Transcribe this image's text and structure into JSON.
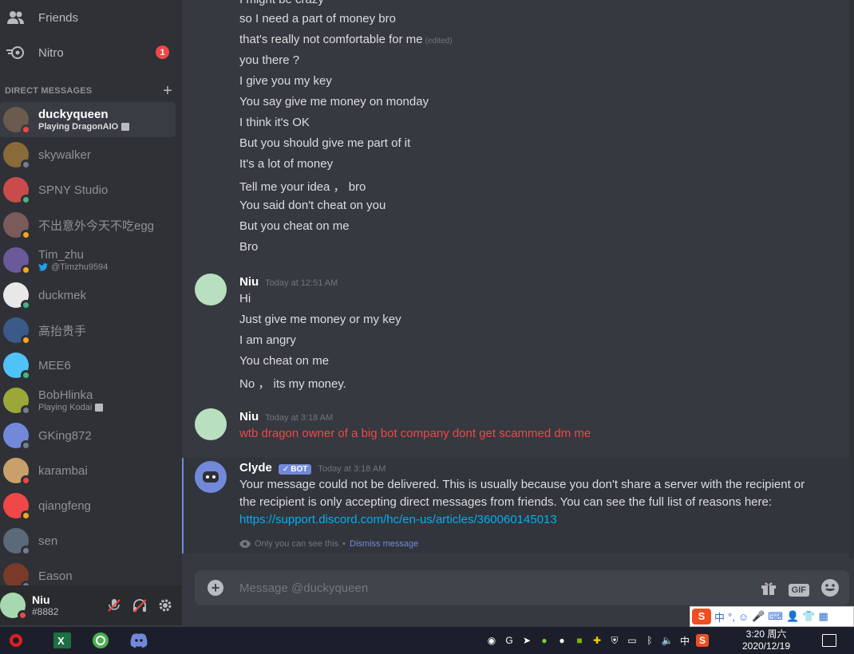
{
  "sidebar": {
    "nav": [
      {
        "label": "Friends",
        "icon": "friends-icon"
      },
      {
        "label": "Nitro",
        "icon": "nitro-icon",
        "badge": "1"
      }
    ],
    "dm_header": "DIRECT MESSAGES",
    "dms": [
      {
        "name": "duckyqueen",
        "sub": "Playing DragonAIO",
        "status": "dnd",
        "color": "#6b5a4e"
      },
      {
        "name": "skywalker",
        "sub": "",
        "status": "offline",
        "color": "#8b6a3a"
      },
      {
        "name": "SPNY Studio",
        "sub": "",
        "status": "online",
        "color": "#c94b4b"
      },
      {
        "name": "不出意外今天不吃egg",
        "sub": "",
        "status": "idle",
        "color": "#7a5a5a"
      },
      {
        "name": "Tim_zhu",
        "sub": "@Timzhu9594",
        "status": "idle",
        "color": "#6a5a9a"
      },
      {
        "name": "duckmek",
        "sub": "",
        "status": "online",
        "color": "#e8e8e8"
      },
      {
        "name": "高抬贵手",
        "sub": "",
        "status": "idle",
        "color": "#3b5a8a"
      },
      {
        "name": "MEE6",
        "sub": "",
        "status": "online",
        "color": "#4fc3f7"
      },
      {
        "name": "BobHlinka",
        "sub": "Playing Kodai",
        "status": "offline",
        "color": "#9aa83a"
      },
      {
        "name": "GKing872",
        "sub": "",
        "status": "offline",
        "color": "#7289da"
      },
      {
        "name": "karambai",
        "sub": "",
        "status": "dnd",
        "color": "#c9a06a"
      },
      {
        "name": "qiangfeng",
        "sub": "",
        "status": "idle",
        "color": "#f04747"
      },
      {
        "name": "sen",
        "sub": "",
        "status": "offline",
        "color": "#5a6a7a"
      },
      {
        "name": "Eason",
        "sub": "",
        "status": "offline",
        "color": "#7a3a2a"
      }
    ]
  },
  "user": {
    "name": "Niu",
    "tag": "#8882"
  },
  "chat": {
    "partial_top": "I might be crazy",
    "lines1": [
      "so I need a part of money bro",
      "that's really not comfortable for me",
      "you there ?",
      "I give you my key",
      "You say give me money on monday",
      "I think it's OK",
      "But you should give me part of it",
      "It's a lot of money",
      "Tell me your idea ，  bro",
      "You said don't cheat on you",
      "But you cheat on me",
      "Bro"
    ],
    "edited": "(edited)",
    "m2": {
      "author": "Niu",
      "time": "Today at 12:51 AM",
      "lines": [
        "Hi",
        "Just give me money or my key",
        "I am angry",
        "You cheat on me",
        "No ，  its my money."
      ]
    },
    "m3": {
      "author": "Niu",
      "time": "Today at 3:18 AM",
      "text": "wtb dragon owner of a big bot company dont get scammed dm me"
    },
    "clyde": {
      "author": "Clyde",
      "bot": "BOT",
      "time": "Today at 3:18 AM",
      "text": "Your message could not be delivered. This is usually because you don't share a server with the recipient or the recipient is only accepting direct messages from friends. You can see the full list of reasons here:",
      "link": "https://support.discord.com/hc/en-us/articles/360060145013",
      "only_you": "Only you can see this",
      "dismiss": "Dismiss message"
    },
    "composer_placeholder": "Message @duckyqueen",
    "gif": "GIF"
  },
  "ime": {
    "logo": "S",
    "mode": "中"
  },
  "taskbar": {
    "ime_lang": "中",
    "time": "3:20 周六",
    "date": "2020/12/19"
  }
}
